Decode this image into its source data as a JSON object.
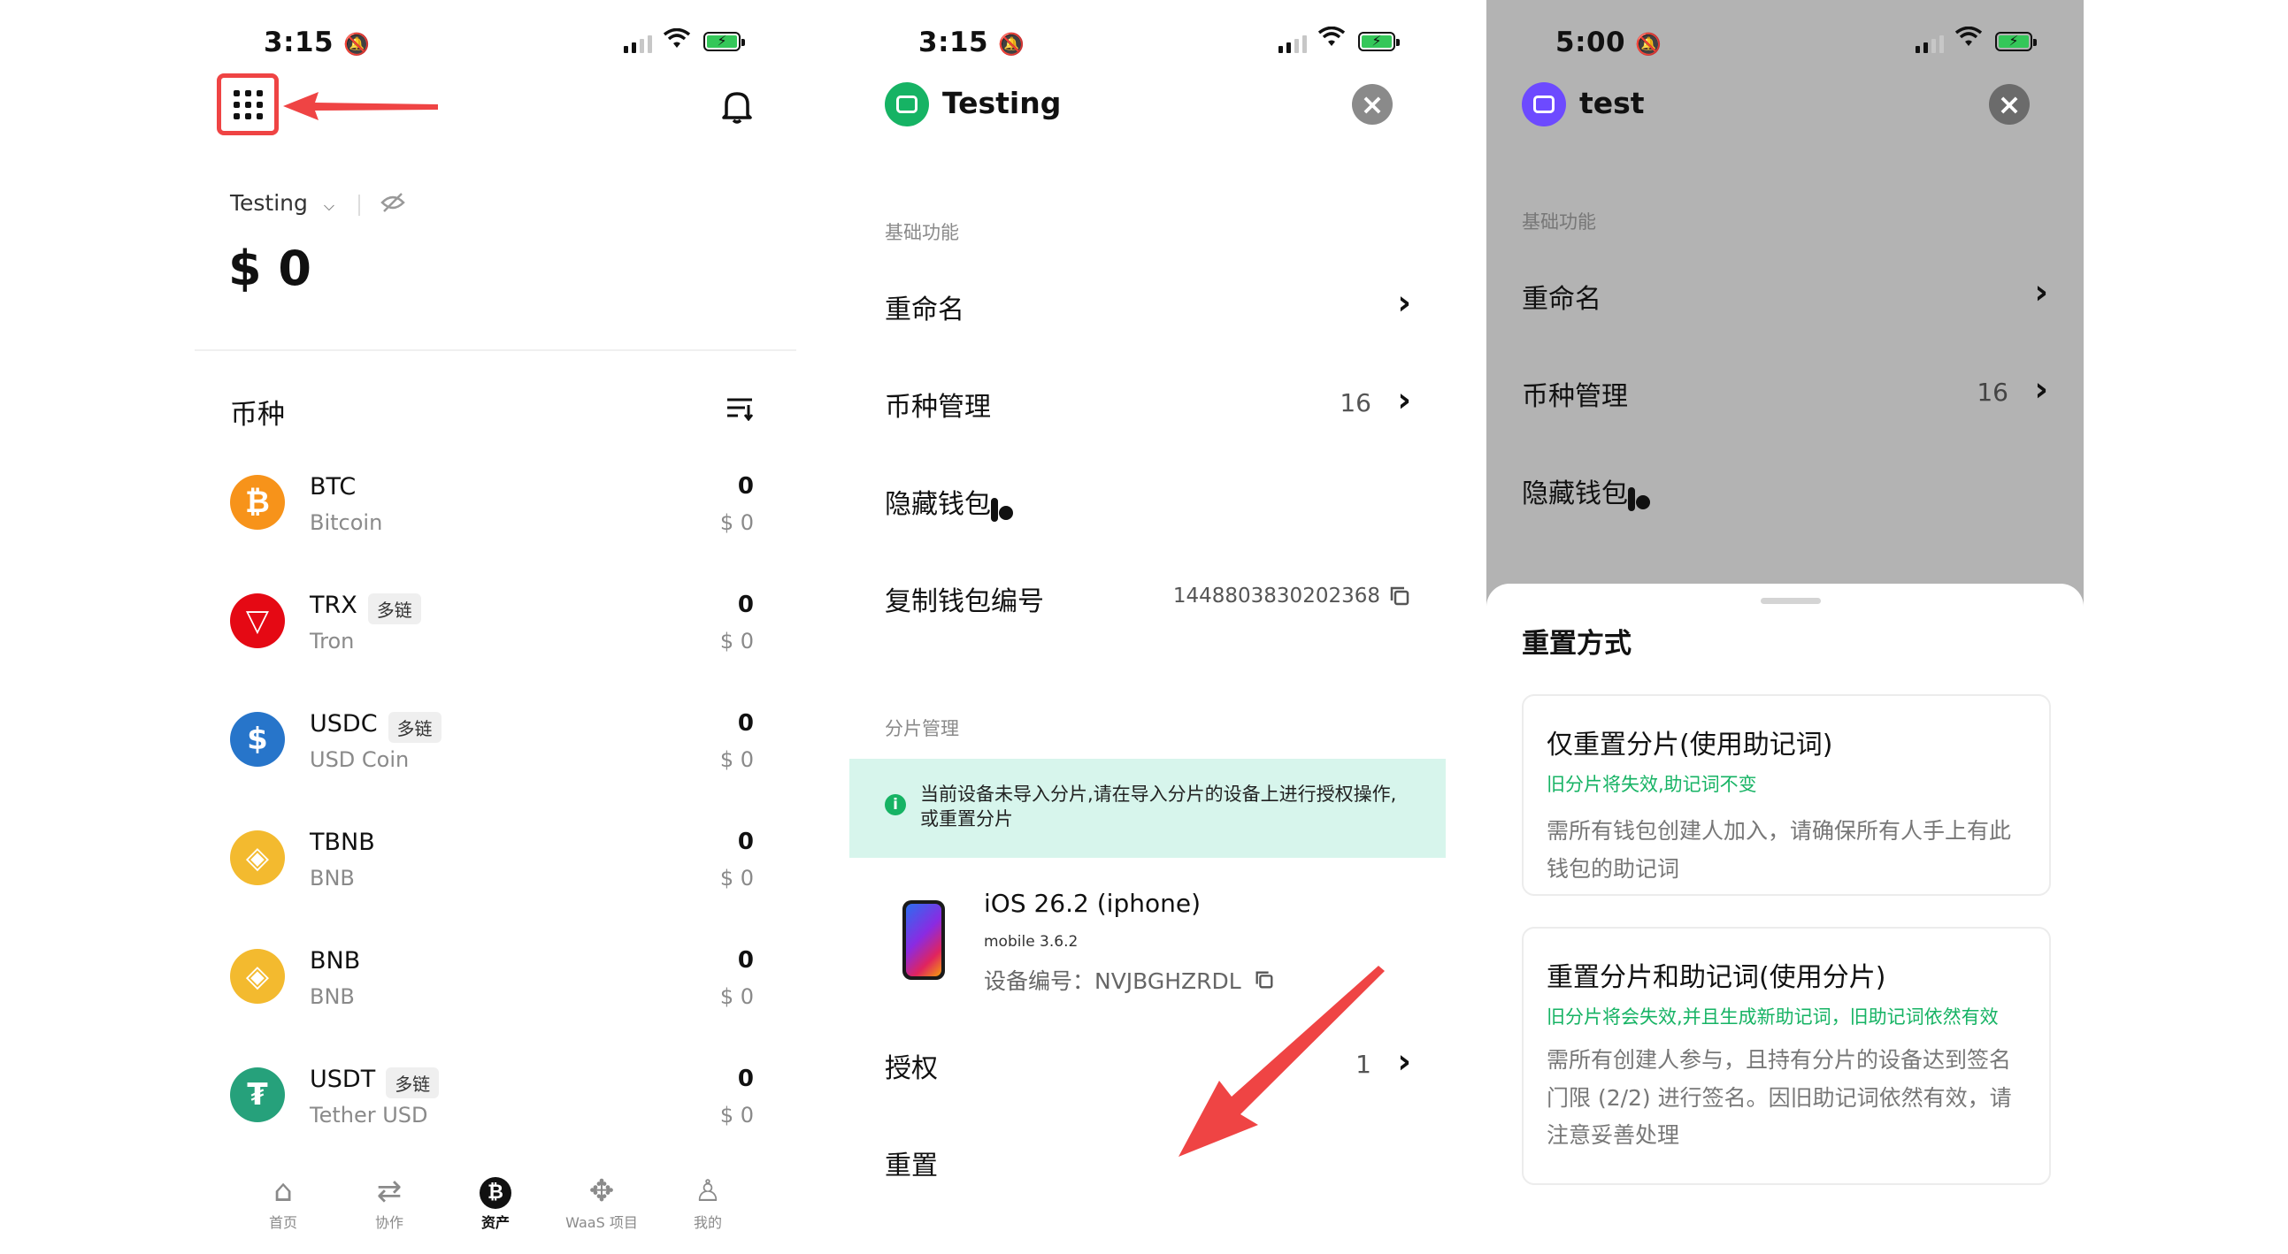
{
  "screen1": {
    "status_time": "3:15",
    "wallet_name": "Testing",
    "balance": "$ 0",
    "section_title": "币种",
    "coins": [
      {
        "symbol": "BTC",
        "name": "Bitcoin",
        "badge": "",
        "amount": "0",
        "usd": "$ 0",
        "color": "#f7931a",
        "glyph": "₿"
      },
      {
        "symbol": "TRX",
        "name": "Tron",
        "badge": "多链",
        "amount": "0",
        "usd": "$ 0",
        "color": "#e50914",
        "glyph": "▽"
      },
      {
        "symbol": "USDC",
        "name": "USD Coin",
        "badge": "多链",
        "amount": "0",
        "usd": "$ 0",
        "color": "#2775ca",
        "glyph": "$"
      },
      {
        "symbol": "TBNB",
        "name": "BNB",
        "badge": "",
        "amount": "0",
        "usd": "$ 0",
        "color": "#f3ba2f",
        "glyph": "◈"
      },
      {
        "symbol": "BNB",
        "name": "BNB",
        "badge": "",
        "amount": "0",
        "usd": "$ 0",
        "color": "#f3ba2f",
        "glyph": "◈"
      },
      {
        "symbol": "USDT",
        "name": "Tether USD",
        "badge": "多链",
        "amount": "0",
        "usd": "$ 0",
        "color": "#26a17b",
        "glyph": "₮"
      }
    ],
    "tabs": [
      {
        "label": "首页",
        "icon": "home-icon",
        "glyph": "⌂",
        "active": false
      },
      {
        "label": "协作",
        "icon": "collab-icon",
        "glyph": "⇄",
        "active": false
      },
      {
        "label": "资产",
        "icon": "assets-icon",
        "glyph": "●",
        "active": true
      },
      {
        "label": "WaaS 项目",
        "icon": "waas-icon",
        "glyph": "✥",
        "active": false
      },
      {
        "label": "我的",
        "icon": "profile-icon",
        "glyph": "♙",
        "active": false
      }
    ]
  },
  "screen2": {
    "status_time": "3:15",
    "title": "Testing",
    "section_basic": "基础功能",
    "rename": "重命名",
    "coin_manage": "币种管理",
    "coin_count": "16",
    "hide_wallet": "隐藏钱包",
    "copy_id": "复制钱包编号",
    "wallet_id": "1448803830202368",
    "section_shard": "分片管理",
    "notice": "当前设备未导入分片,请在导入分片的设备上进行授权操作,或重置分片",
    "device_name": "iOS 26.2 (iphone)",
    "device_version": "mobile 3.6.2",
    "device_id_label": "设备编号：NVJBGHZRDL",
    "authorize": "授权",
    "authorize_count": "1",
    "reset": "重置"
  },
  "screen3": {
    "status_time": "5:00",
    "title": "test",
    "section_basic": "基础功能",
    "rename": "重命名",
    "coin_manage": "币种管理",
    "coin_count": "16",
    "hide_wallet": "隐藏钱包",
    "sheet_title": "重置方式",
    "option1": {
      "title": "仅重置分片(使用助记词)",
      "sub": "旧分片将失效,助记词不变",
      "desc": "需所有钱包创建人加入，请确保所有人手上有此钱包的助记词"
    },
    "option2": {
      "title": "重置分片和助记词(使用分片)",
      "sub": "旧分片将会失效,并且生成新助记词，旧助记词依然有效",
      "desc": "需所有创建人参与，且持有分片的设备达到签名门限 (2/2) 进行签名。因旧助记词依然有效，请注意妥善处理"
    }
  },
  "colors": {
    "accent_red": "#ef4444",
    "green": "#16b364",
    "notice_bg": "#d7f5ec",
    "overlay": "#b3b3b3",
    "purple": "#6d4aff"
  }
}
